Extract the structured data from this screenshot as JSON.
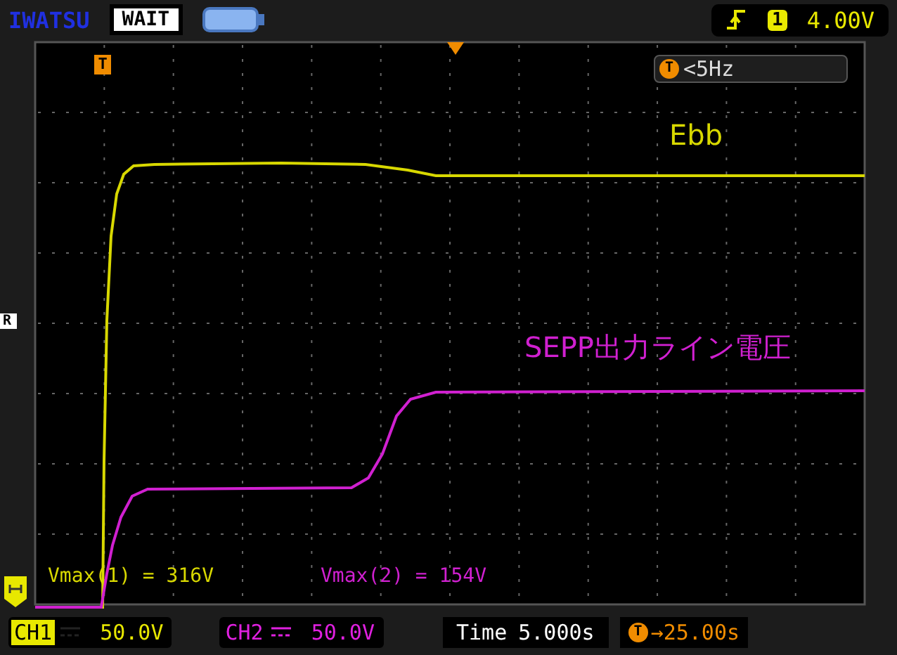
{
  "brand": "IWATSU",
  "run_state": "WAIT",
  "trigger": {
    "channel": "1",
    "level": "4.00V"
  },
  "markers": {
    "trigger": "T",
    "reference": "R"
  },
  "frequency": {
    "marker": "T",
    "value": "<5Hz"
  },
  "traces": [
    {
      "label": "Ebb",
      "color": "#d8d800"
    },
    {
      "label": "SEPP出力ライン電圧",
      "color": "#d020d0"
    }
  ],
  "measurements": [
    "Vmax(1) = 316V",
    "Vmax(2) = 154V"
  ],
  "channels": [
    {
      "name": "CH1",
      "scale": "50.0V",
      "selected": true,
      "color": "#e8e800"
    },
    {
      "name": "CH2",
      "scale": "50.0V",
      "selected": false,
      "color": "#e020e0"
    }
  ],
  "timebase": {
    "label": "Time",
    "value": "5.000s"
  },
  "trigger_offset": {
    "marker": "T",
    "value": "→25.00s"
  }
}
